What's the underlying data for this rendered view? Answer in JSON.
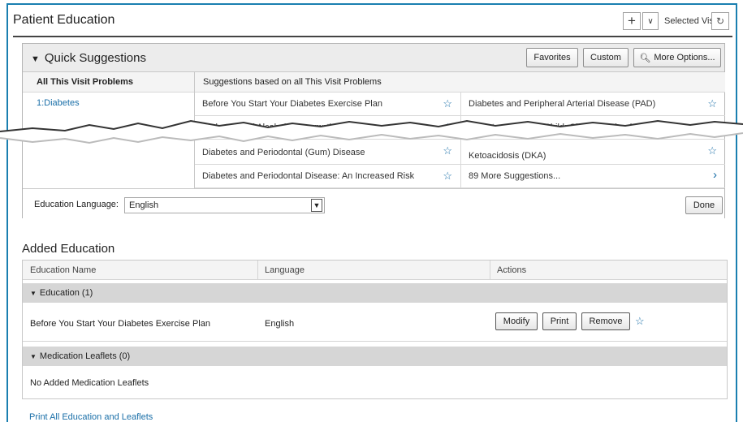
{
  "header": {
    "title": "Patient Education",
    "plus_icon": "+",
    "dropdown_icon": "∨",
    "visit_label": "Selected Visit",
    "refresh_icon": "↻"
  },
  "quick_suggestions": {
    "title": "Quick Suggestions",
    "buttons": {
      "favorites": "Favorites",
      "custom": "Custom",
      "more_options": "More Options..."
    },
    "problems_header": "All This Visit Problems",
    "problems": [
      "1:Diabetes"
    ],
    "suggestions_header": "Suggestions based on all This Visit Problems",
    "suggestions": [
      "Before You Start Your Diabetes Exercise Plan",
      "Diabetes and Peripheral Arterial Disease (PAD)",
      "Diabetes and Alcohol Consumption",
      "Diabetes and Your Child: Checking Blood Sugar",
      "Diabetes and Periodontal (Gum) Disease",
      "Ketoacidosis (DKA)",
      "Diabetes and Periodontal Disease: An Increased Risk",
      "89 More Suggestions..."
    ],
    "language_label": "Education Language:",
    "language_value": "English",
    "done_label": "Done"
  },
  "added_education": {
    "title": "Added Education",
    "columns": [
      "Education Name",
      "Language",
      "Actions"
    ],
    "groups": [
      {
        "label": "Education (1)",
        "rows": [
          {
            "name": "Before You Start Your Diabetes Exercise Plan",
            "language": "English"
          }
        ]
      },
      {
        "label": "Medication Leaflets (0)",
        "empty": "No Added Medication Leaflets"
      }
    ],
    "actions": {
      "modify": "Modify",
      "print": "Print",
      "remove": "Remove"
    },
    "print_all": "Print All Education and Leaflets"
  },
  "colors": {
    "link": "#1a6fa8",
    "frame": "#1a7fb0",
    "group_bg": "#d6d6d6"
  }
}
